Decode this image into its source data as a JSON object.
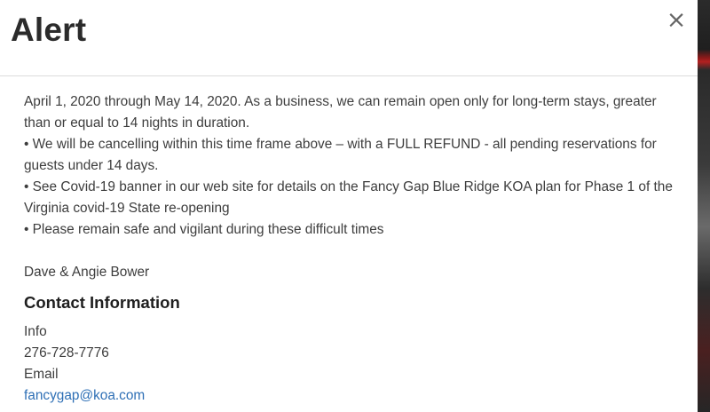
{
  "modal": {
    "title": "Alert",
    "close_label": "×"
  },
  "body": {
    "paragraphs": [
      "April 1, 2020 through May 14, 2020. As a business, we can remain open only for long-term stays, greater than or equal to 14 nights in duration.",
      "• We will be cancelling within this time frame above – with a FULL REFUND - all pending reservations for guests under 14 days.",
      "• See Covid-19 banner in our web site for details on the Fancy Gap Blue Ridge KOA plan for Phase 1 of the Virginia covid-19 State re-opening",
      "• Please remain safe and vigilant during these difficult times"
    ],
    "signature": "Dave & Angie Bower"
  },
  "contact": {
    "heading": "Contact Information",
    "info_label": "Info",
    "phone": "276-728-7776",
    "email_label": "Email",
    "email": "fancygap@koa.com"
  },
  "colors": {
    "title": "#2b2b2b",
    "text": "#3d3d3d",
    "link": "#2e6fb5"
  }
}
